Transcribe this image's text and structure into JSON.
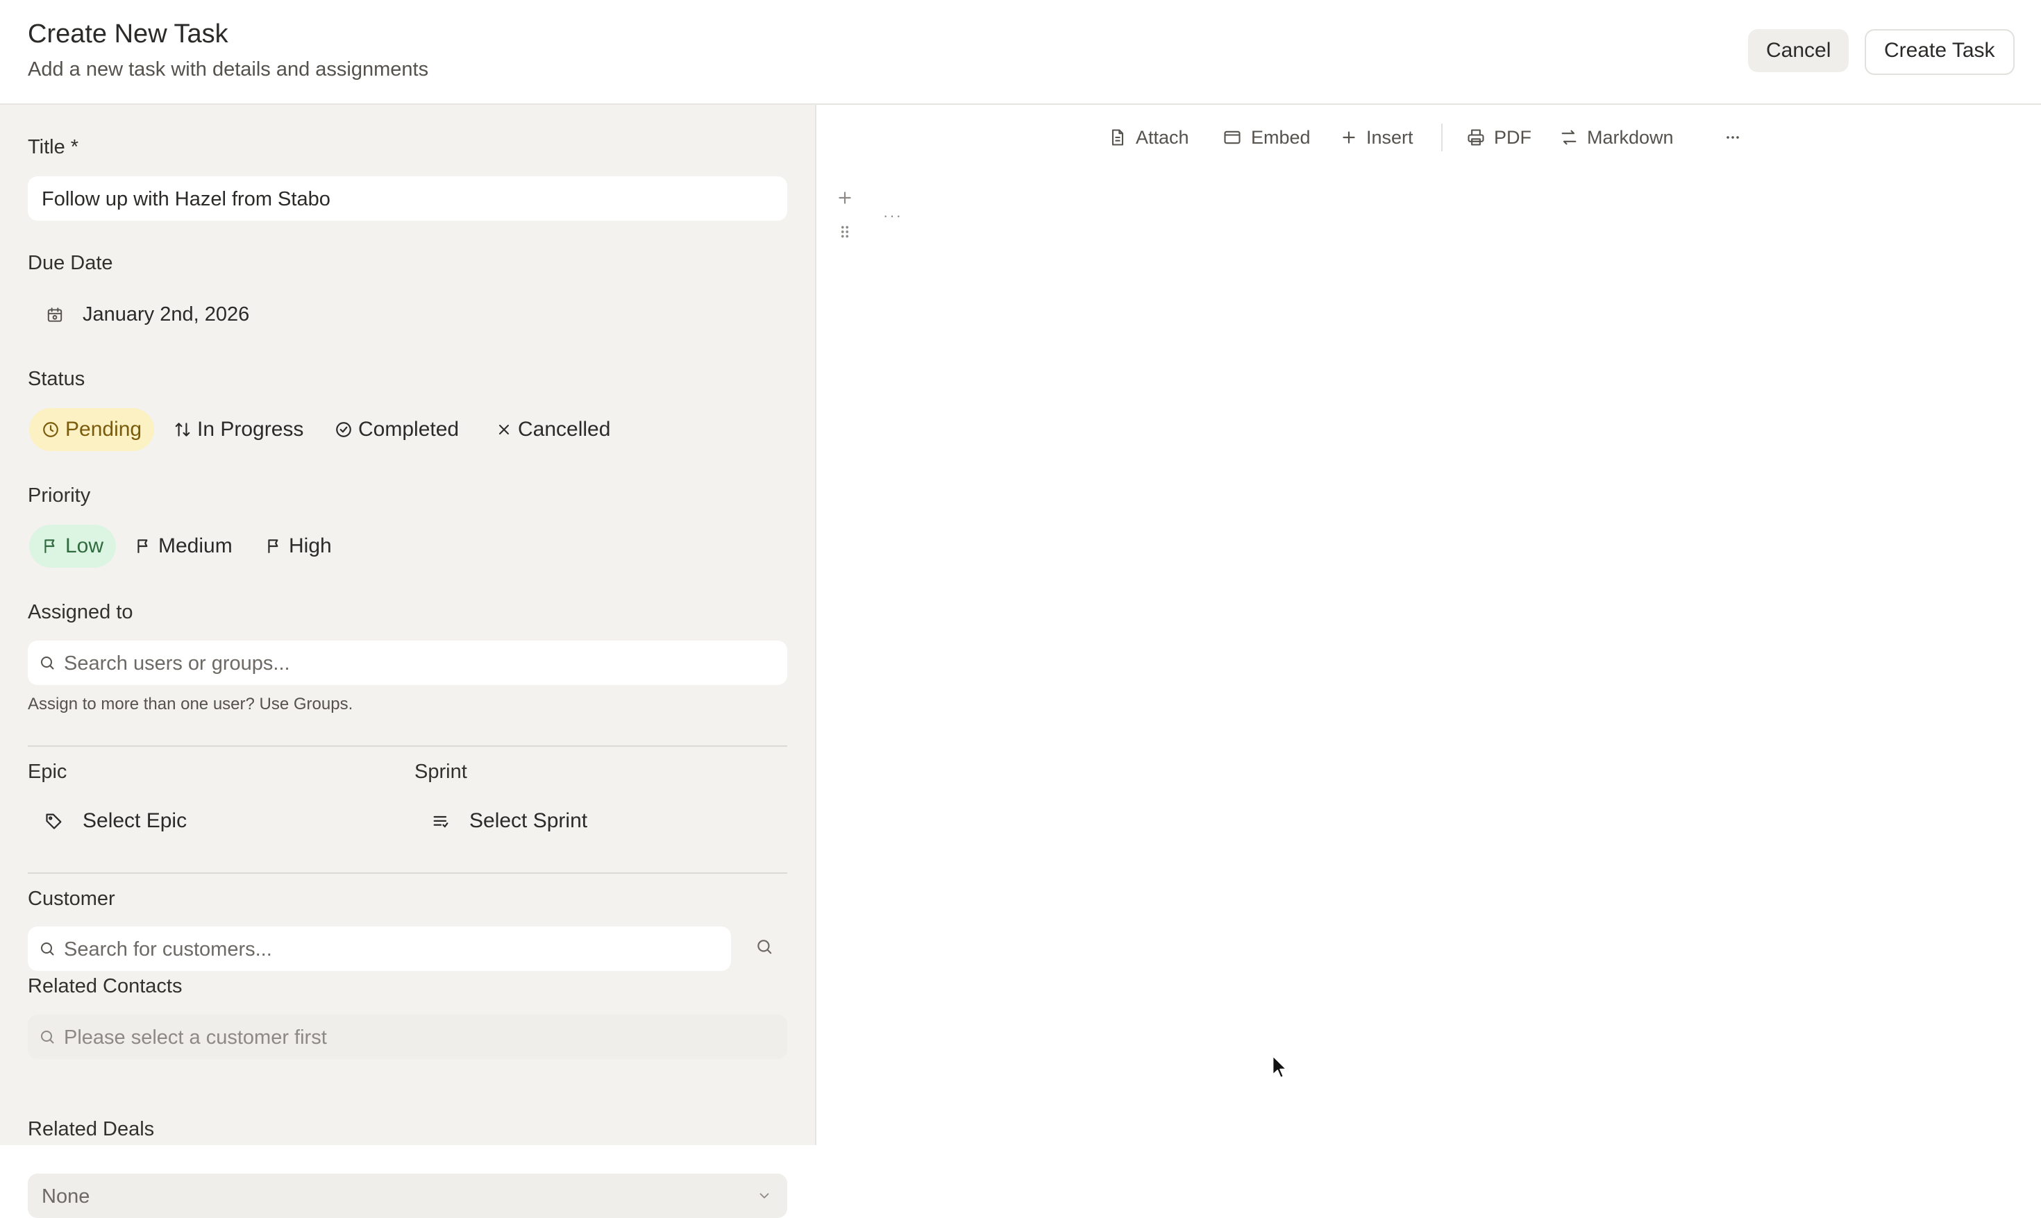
{
  "header": {
    "title": "Create New Task",
    "subtitle": "Add a new task with details and assignments",
    "cancel_label": "Cancel",
    "create_label": "Create Task"
  },
  "form": {
    "title_label": "Title *",
    "title_value": "Follow up with Hazel from Stabo",
    "due_date_label": "Due Date",
    "due_date_value": "January 2nd, 2026",
    "status_label": "Status",
    "status_options": [
      "Pending",
      "In Progress",
      "Completed",
      "Cancelled"
    ],
    "status_selected": "Pending",
    "priority_label": "Priority",
    "priority_options": [
      "Low",
      "Medium",
      "High"
    ],
    "priority_selected": "Low",
    "assigned_label": "Assigned to",
    "assigned_placeholder": "Search users or groups...",
    "assigned_hint": "Assign to more than one user? Use Groups.",
    "epic_label": "Epic",
    "epic_value": "Select Epic",
    "sprint_label": "Sprint",
    "sprint_value": "Select Sprint",
    "customer_label": "Customer",
    "customer_placeholder": "Search for customers...",
    "related_contacts_label": "Related Contacts",
    "related_contacts_placeholder": "Please select a customer first",
    "related_contacts_select": "None",
    "related_deals_label": "Related Deals"
  },
  "editor": {
    "toolbar": {
      "attach": "Attach",
      "embed": "Embed",
      "insert": "Insert",
      "pdf": "PDF",
      "markdown": "Markdown"
    },
    "more_dots": "···"
  },
  "colors": {
    "pending_bg": "#fcf1c2",
    "pending_fg": "#7a5b0c",
    "low_bg": "#dcf4e2",
    "low_fg": "#2f6b3f",
    "panel_bg": "#f3f2ef"
  }
}
